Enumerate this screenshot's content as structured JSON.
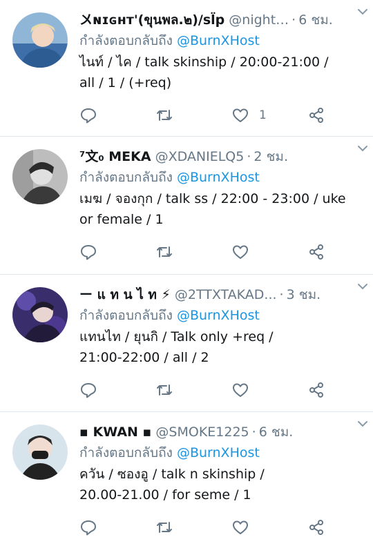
{
  "tweets": [
    {
      "name": "〤ɴɪɢʜᴛ'(ขุนพล.๒)/sl̈p",
      "handle": "@night…",
      "time": "6 ชม.",
      "reply_prefix": "กำลังตอบกลับถึง",
      "reply_mention": "@BurnXHost",
      "text": "ไนท์ / ไค / talk skinship / 20:00-21:00 /\nall / 1 / (+req)",
      "like_count": "1"
    },
    {
      "name": "⁷文₀ MEKA",
      "handle": "@XDANIELQ5",
      "time": "2 ชม.",
      "reply_prefix": "กำลังตอบกลับถึง",
      "reply_mention": "@BurnXHost",
      "text": "เมฆ / จองกุก / talk ss / 22:00 - 23:00 / uke\nor female / 1",
      "like_count": ""
    },
    {
      "name": "ー แ ท น ไ ท ⚡",
      "handle": "@2TTXTAKAD...",
      "time": "3 ชม.",
      "reply_prefix": "กำลังตอบกลับถึง",
      "reply_mention": "@BurnXHost",
      "text": "แทนไท / ยุนกิ / Talk only +req /\n21:00-22:00 / all / 2",
      "like_count": ""
    },
    {
      "name": "▪ KWAN ▪",
      "handle": "@SMOKE1225",
      "time": "6 ชม.",
      "reply_prefix": "กำลังตอบกลับถึง",
      "reply_mention": "@BurnXHost",
      "text": "ควัน / ซองอู / talk n skinship /\n20.00-21.00 /  for seme / 1",
      "like_count": ""
    }
  ],
  "icons": {
    "reply": "reply-icon",
    "retweet": "retweet-icon",
    "like": "heart-icon",
    "share": "share-icon",
    "caret": "chevron-down-icon"
  },
  "colors": {
    "text": "#14171a",
    "secondary": "#657786",
    "mention": "#1b95e0",
    "divider": "#e1e8ed"
  }
}
